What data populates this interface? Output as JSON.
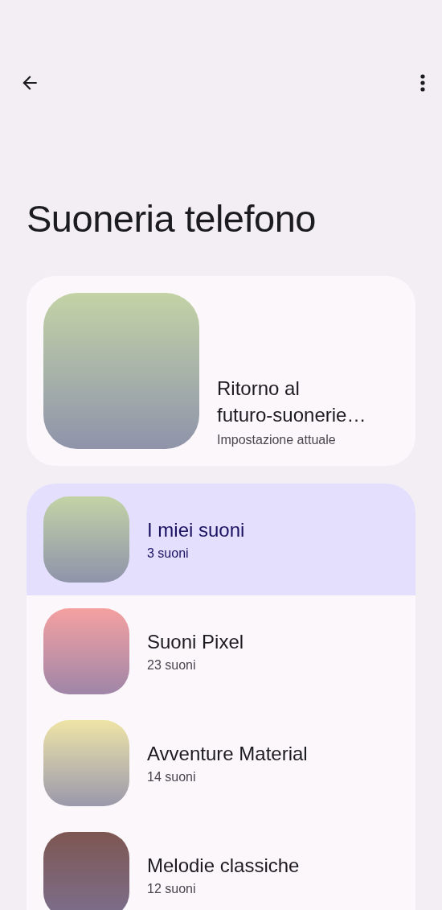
{
  "title": "Suoneria telefono",
  "current": {
    "title": "Ritorno al futuro-suonerie…",
    "subtitle": "Impostazione attuale",
    "color": "#c3d3a5"
  },
  "categories": [
    {
      "name": "I miei suoni",
      "count": "3 suoni",
      "selected": true,
      "color": "#c3d3a5"
    },
    {
      "name": "Suoni Pixel",
      "count": "23 suoni",
      "selected": false,
      "color": "#f5a0a0"
    },
    {
      "name": "Avventure Material",
      "count": "14 suoni",
      "selected": false,
      "color": "#efe4a5"
    },
    {
      "name": "Melodie classiche",
      "count": "12 suoni",
      "selected": false,
      "color": "#7d5651"
    }
  ]
}
